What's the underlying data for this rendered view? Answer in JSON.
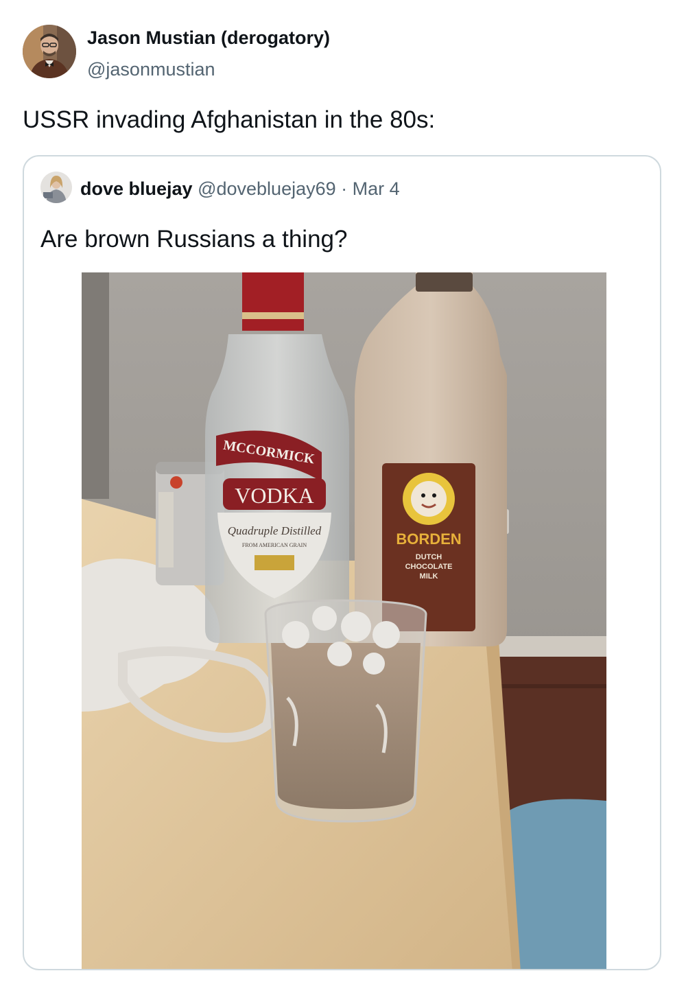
{
  "tweet": {
    "author_name": "Jason Mustian (derogatory)",
    "author_handle": "@jasonmustian",
    "text": "USSR invading Afghanistan in the 80s:",
    "avatar_icon": "profile-photo-man-bowtie"
  },
  "quote": {
    "author_name": "dove bluejay",
    "author_handle": "@dovebluejay69",
    "separator": "·",
    "date": "Mar 4",
    "text": "Are brown Russians a thing?",
    "avatar_icon": "profile-photo-woman"
  },
  "photo": {
    "vodka_brand": "MCCORMICK",
    "vodka_word": "VODKA",
    "vodka_tagline": "Quadruple Distilled",
    "vodka_subline": "FROM AMERICAN GRAIN",
    "milk_brand": "BORDEN",
    "milk_line1": "DUTCH",
    "milk_line2": "CHOCOLATE",
    "milk_line3": "MILK"
  },
  "colors": {
    "text_primary": "#0f1419",
    "text_secondary": "#536471",
    "card_border": "#cfd9de"
  }
}
